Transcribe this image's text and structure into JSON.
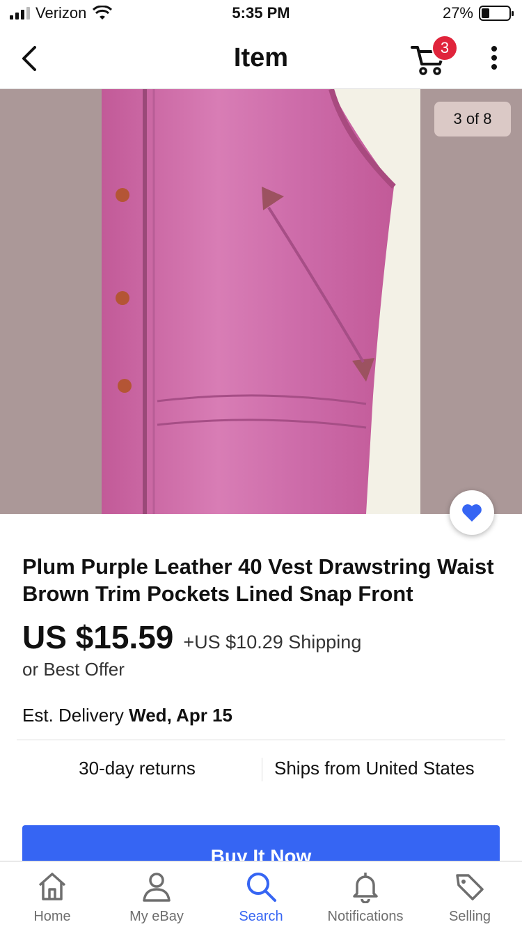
{
  "status_bar": {
    "carrier": "Verizon",
    "time": "5:35 PM",
    "battery": "27%"
  },
  "nav": {
    "title": "Item",
    "cart_count": "3"
  },
  "gallery": {
    "counter": "3 of 8"
  },
  "item": {
    "title": "Plum Purple Leather 40 Vest Drawstring Waist Brown Trim Pockets Lined Snap Front",
    "price": "US $15.59",
    "shipping": "+US $10.29 Shipping",
    "best_offer": "or Best Offer",
    "delivery_label": "Est. Delivery",
    "delivery_date": "Wed, Apr 15",
    "returns": "30-day returns",
    "ships_from": "Ships from United States"
  },
  "actions": {
    "buy_now": "Buy It Now"
  },
  "tabs": [
    {
      "label": "Home",
      "icon": "home-icon"
    },
    {
      "label": "My eBay",
      "icon": "person-icon"
    },
    {
      "label": "Search",
      "icon": "search-icon"
    },
    {
      "label": "Notifications",
      "icon": "bell-icon"
    },
    {
      "label": "Selling",
      "icon": "tag-icon"
    }
  ],
  "colors": {
    "accent": "#3665f3",
    "badge": "#e0243b"
  }
}
